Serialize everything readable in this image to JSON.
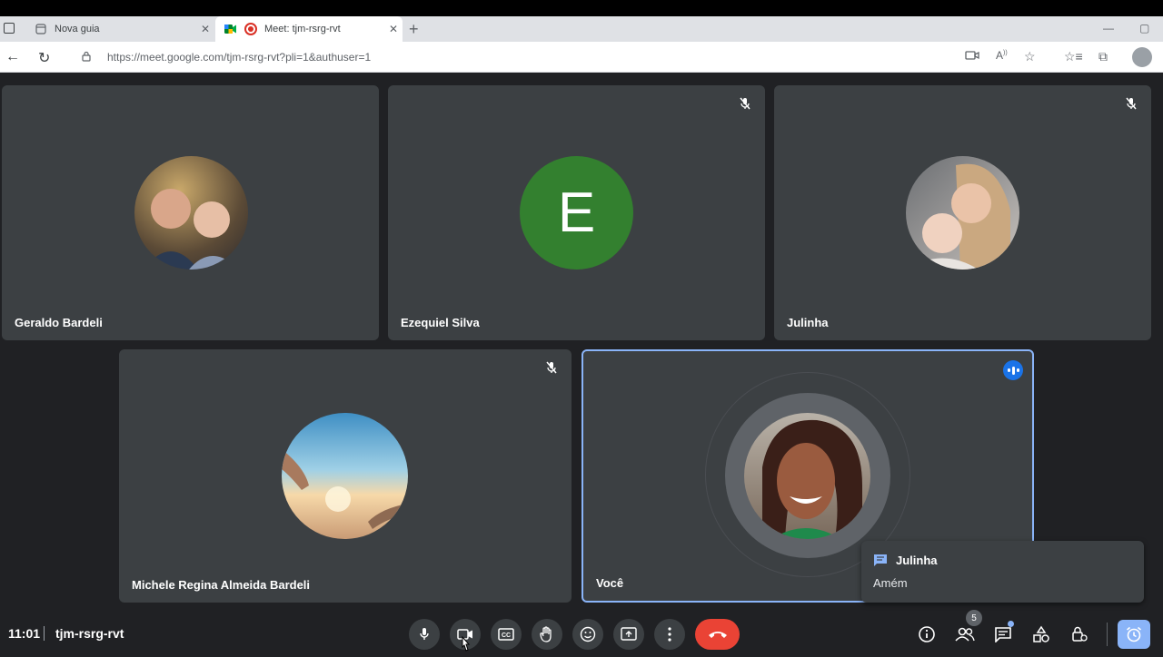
{
  "browser": {
    "tabs": [
      {
        "label": "Nova guia",
        "active": false
      },
      {
        "label": "Meet: tjm-rsrg-rvt",
        "active": true
      }
    ],
    "url_host": "https://meet.google.com",
    "url_path": "/tjm-rsrg-rvt?pli=1&authuser=1"
  },
  "participants": [
    {
      "name": "Geraldo Bardeli",
      "muted": false,
      "avatar": "photo"
    },
    {
      "name": "Ezequiel Silva",
      "muted": true,
      "avatar": "letter",
      "letter": "E",
      "color": "#33802f"
    },
    {
      "name": "Julinha",
      "muted": true,
      "avatar": "photo"
    },
    {
      "name": "Michele Regina Almeida Bardeli",
      "muted": true,
      "avatar": "photo"
    },
    {
      "name": "Você",
      "muted": false,
      "avatar": "photo",
      "speaking": true
    }
  ],
  "chat_popup": {
    "sender": "Julinha",
    "message": "Amém"
  },
  "controls": {
    "time": "11:01",
    "meeting_code": "tjm-rsrg-rvt",
    "participants_count": "5",
    "hangup_color": "#ea4335",
    "accent": "#8ab4f8"
  }
}
